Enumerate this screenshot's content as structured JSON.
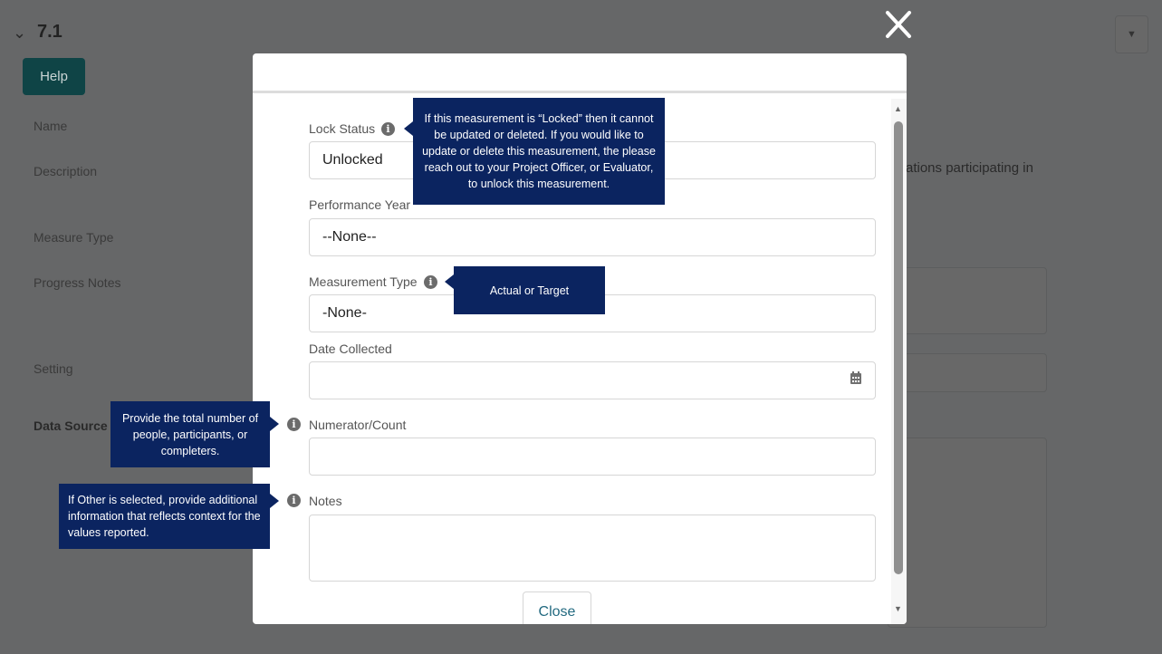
{
  "background": {
    "section_title": "7.1",
    "help_label": "Help",
    "labels": [
      "Name",
      "Description",
      "Measure Type",
      "Progress Notes",
      "Setting",
      "Data Source"
    ],
    "description_fragment": "ations participating in"
  },
  "modal": {
    "fields": {
      "lock_status": {
        "label": "Lock Status",
        "value": "Unlocked"
      },
      "performance_year": {
        "label": "Performance Year",
        "value": "--None--"
      },
      "measurement_type": {
        "label": "Measurement Type",
        "value": "-None-"
      },
      "date_collected": {
        "label": "Date Collected",
        "value": ""
      },
      "numerator": {
        "label": "Numerator/Count",
        "value": ""
      },
      "notes": {
        "label": "Notes",
        "value": ""
      }
    },
    "close_label": "Close"
  },
  "tooltips": {
    "lock_status": "If this measurement is “Locked” then it cannot be updated or deleted. If you would like to update or delete this measurement, the please reach out to your Project Officer, or Evaluator, to unlock this measurement.",
    "measurement_type": "Actual or Target",
    "numerator": "Provide the total number of people, participants, or completers.",
    "notes": "If Other is selected, provide additional information that reflects context for the values reported."
  },
  "colors": {
    "tooltip_bg": "#0b2460",
    "help_button": "#0f4446",
    "overlay": "#666768"
  }
}
